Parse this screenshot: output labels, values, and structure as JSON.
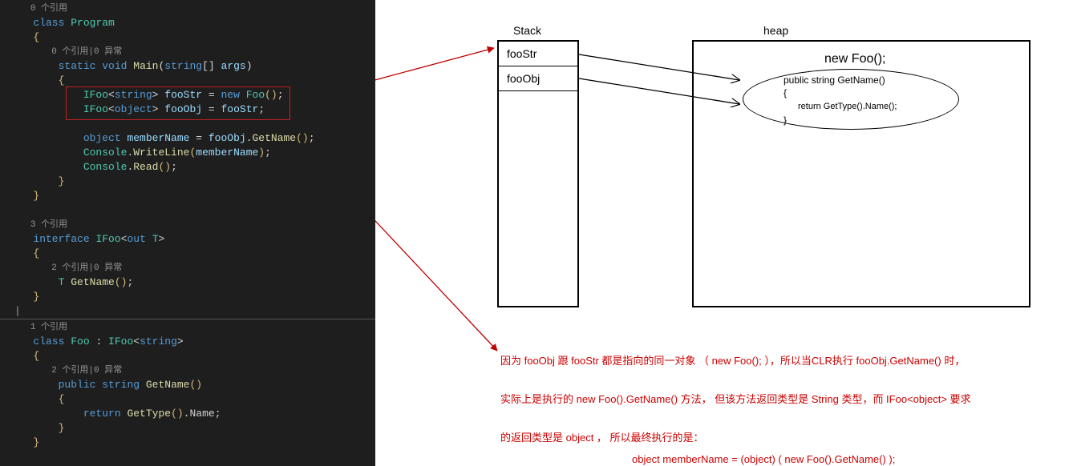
{
  "lens": {
    "l0": "0 个引用",
    "l1": "0 个引用|0 异常",
    "l2": "3 个引用",
    "l3": "2 个引用|0 异常",
    "l4": "1 个引用",
    "l5": "2 个引用|0 异常"
  },
  "code": {
    "kw_class": "class",
    "Program": "Program",
    "kw_static": "static",
    "kw_void": "void",
    "Main": "Main",
    "kw_string": "string",
    "args": "args",
    "IFoo": "IFoo",
    "fooStr": "fooStr",
    "kw_new": "new",
    "Foo": "Foo",
    "kw_object": "object",
    "fooObj": "fooObj",
    "memberName": "memberName",
    "GetName": "GetName",
    "Console": "Console",
    "WriteLine": "WriteLine",
    "Read": "Read",
    "kw_interface": "interface",
    "kw_out": "out",
    "T": "T",
    "kw_public": "public",
    "kw_return": "return",
    "GetType": "GetType",
    "Name": "Name"
  },
  "diagram": {
    "stack": "Stack",
    "heap": "heap",
    "fooStr": "fooStr",
    "fooObj": "fooObj",
    "newFoo": "new Foo();",
    "m1": "public string GetName()",
    "m2": "{",
    "m3": "return GetType().Name();",
    "m4": "}"
  },
  "expl": {
    "l1": "因为 fooObj 跟 fooStr 都是指向的同一对象 （ new Foo();  ），所以当CLR执行 fooObj.GetName() 时，",
    "l2": "实际上是执行的 new Foo().GetName() 方法， 但该方法返回类型是 String 类型，而 IFoo<object> 要求",
    "l3": "的返回类型是 object ， 所以最终执行的是：",
    "l4": "object memberName = (object) ( new Foo().GetName() );"
  }
}
